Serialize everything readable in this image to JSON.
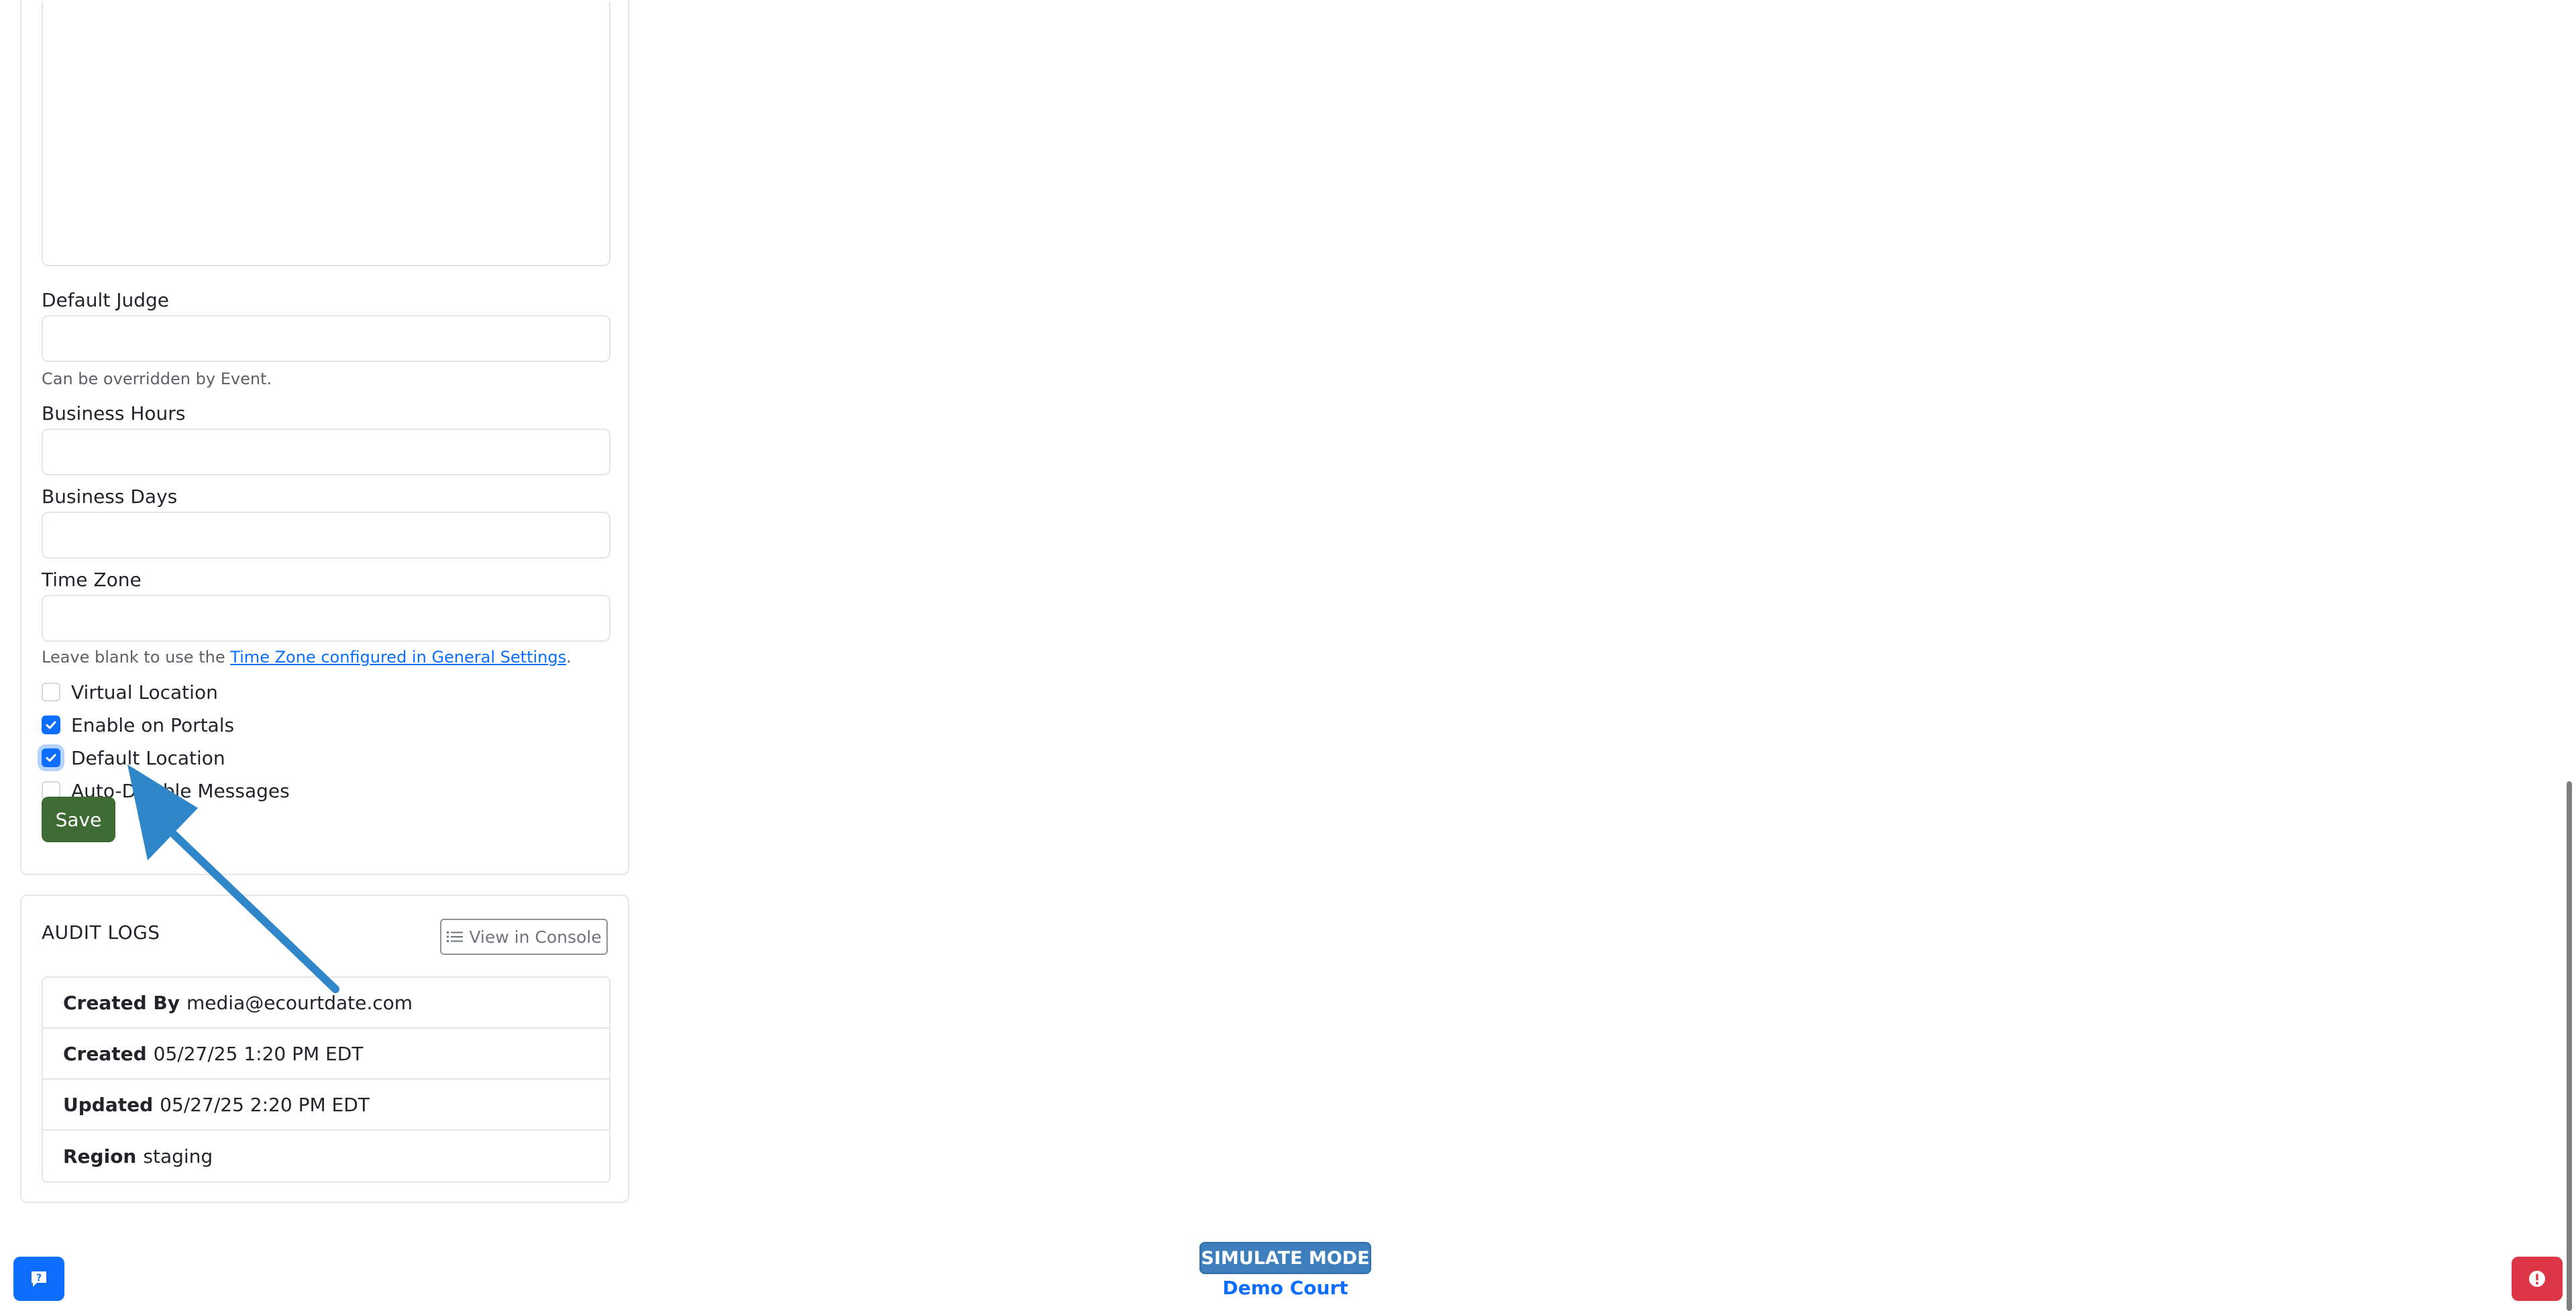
{
  "form": {
    "default_judge_label": "Default Judge",
    "default_judge_help": "Can be overridden by Event.",
    "business_hours_label": "Business Hours",
    "business_days_label": "Business Days",
    "time_zone_label": "Time Zone",
    "time_zone_help_prefix": "Leave blank to use the ",
    "time_zone_help_link": "Time Zone configured in General Settings",
    "time_zone_help_suffix": ".",
    "checkboxes": [
      {
        "label": "Virtual Location",
        "checked": false
      },
      {
        "label": "Enable on Portals",
        "checked": true
      },
      {
        "label": "Default Location",
        "checked": true
      },
      {
        "label": "Auto-Disable Messages",
        "checked": false
      }
    ],
    "save_label": "Save"
  },
  "audit": {
    "title": "AUDIT LOGS",
    "console_button_label": "View in Console",
    "console_icon": "list-icon",
    "rows": [
      {
        "key": "Created By",
        "value": "media@ecourtdate.com"
      },
      {
        "key": "Created",
        "value": "05/27/25 1:20 PM EDT"
      },
      {
        "key": "Updated",
        "value": "05/27/25 2:20 PM EDT"
      },
      {
        "key": "Region",
        "value": "staging"
      }
    ]
  },
  "footer": {
    "simulate_mode": "SIMULATE MODE",
    "court_name": "Demo Court",
    "help_icon": "help-chat-icon",
    "alert_icon": "alert-icon"
  },
  "colors": {
    "primary": "#0d6efd",
    "save": "#3e6b34",
    "danger": "#dc3545",
    "simulate_badge": "#3d7fbd",
    "annotation_arrow": "#2f86c8"
  }
}
